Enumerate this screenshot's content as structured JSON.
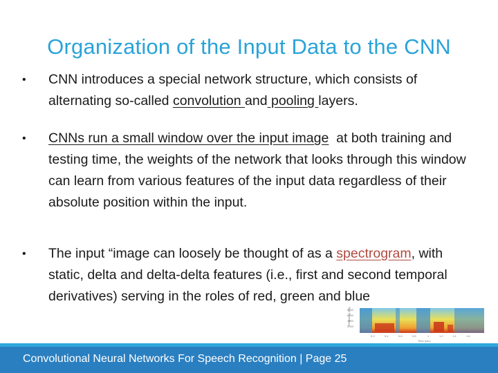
{
  "slide": {
    "title": "Organization of the Input Data to the CNN",
    "bullets": [
      {
        "parts": {
          "a": "CNN introduces a special network structure, which consists of alternating so-called ",
          "u1": "convolution ",
          "b": "and",
          "u2": " pooling ",
          "c": "layers."
        }
      },
      {
        "parts": {
          "u1": "CNNs run a small window over the input image",
          "a": "  at both training and testing time, the weights of the network that looks through this window can learn from various features of the input data regardless of their absolute position within the input."
        }
      },
      {
        "parts": {
          "a": "The input “image can loosely be thought of as a ",
          "link": "spectrogram",
          "b": ", with static, delta and delta-delta features (i.e., first and second temporal derivatives) serving in the roles of red, green and blue"
        }
      }
    ],
    "bullet_glyph": "•"
  },
  "spectrogram": {
    "ylabel": "Frequency (Hz)",
    "xlabel": "Time (sec)",
    "yticks": [
      "8000",
      "6000",
      "4000",
      "2000"
    ],
    "xticks": [
      "0.2",
      "0.4",
      "0.6",
      "0.8",
      "1",
      "1.2",
      "1.4",
      "1.6"
    ]
  },
  "footer": {
    "text": "Convolutional Neural Networks For Speech Recognition | Page  25"
  },
  "colors": {
    "title": "#2aa3d8",
    "footer_band": "#2a7fc0",
    "footer_strip": "#2fa8dc",
    "link": "#b04a3f"
  }
}
